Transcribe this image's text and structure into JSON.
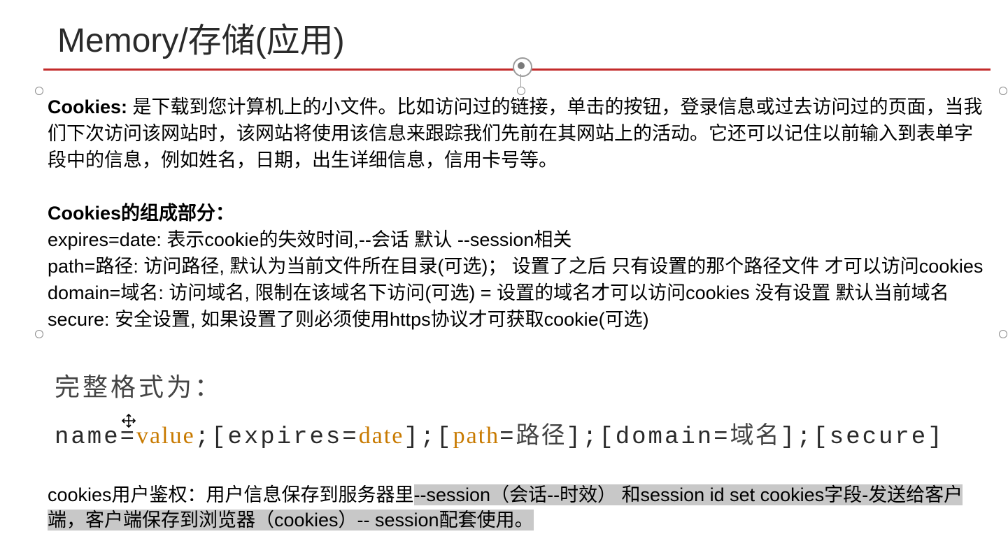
{
  "title": "Memory/存储(应用)",
  "cookies_heading": "Cookies:",
  "cookies_desc": "是下载到您计算机上的小文件。比如访问过的链接，单击的按钮，登录信息或过去访问过的页面，当我们下次访问该网站时，该网站将使用该信息来跟踪我们先前在其网站上的活动。它还可以记住以前输入到表单字段中的信息，例如姓名，日期，出生详细信息，信用卡号等。",
  "components_heading": "Cookies的组成部分：",
  "line_expires": "expires=date: 表示cookie的失效时间,--会话 默认 --session相关",
  "line_path": "path=路径: 访问路径, 默认为当前文件所在目录(可选)；  设置了之后 只有设置的那个路径文件 才可以访问cookies",
  "line_domain": "domain=域名: 访问域名, 限制在该域名下访问(可选) =  设置的域名才可以访问cookies  没有设置 默认当前域名",
  "line_secure": "secure: 安全设置, 如果设置了则必须使用https协议才可获取cookie(可选)",
  "format_title": "完整格式为：",
  "format": {
    "p1": "name=",
    "kw1": "value",
    "p2": ";[expires=",
    "kw2": "date",
    "p3": "];[",
    "kw3": "path",
    "p4": "=",
    "zh1": "路径",
    "p5": "];[domain=",
    "zh2": "域名",
    "p6": "];[secure]"
  },
  "bottom": {
    "lead": "cookies用户鉴权：用户信息保存到服务器里",
    "sel1": "--session（会话--时效） 和session id set cookies字段-发送给客户端，客户端保存到浏览器（cookies）-- session配套使用。"
  }
}
